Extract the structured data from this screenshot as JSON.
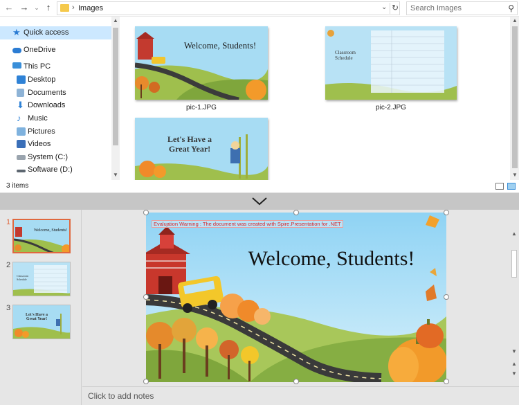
{
  "explorer": {
    "address": {
      "path": "Images"
    },
    "search": {
      "placeholder": "Search Images"
    },
    "nav": {
      "items": [
        {
          "label": "Quick access",
          "icon": "star-icon"
        },
        {
          "label": "OneDrive",
          "icon": "cloud-icon"
        },
        {
          "label": "This PC",
          "icon": "computer-icon"
        },
        {
          "label": "Desktop",
          "icon": "desktop-folder-icon"
        },
        {
          "label": "Documents",
          "icon": "documents-folder-icon"
        },
        {
          "label": "Downloads",
          "icon": "downloads-folder-icon"
        },
        {
          "label": "Music",
          "icon": "music-icon"
        },
        {
          "label": "Pictures",
          "icon": "pictures-folder-icon"
        },
        {
          "label": "Videos",
          "icon": "videos-folder-icon"
        },
        {
          "label": "System (C:)",
          "icon": "drive-icon"
        },
        {
          "label": "Software (D:)",
          "icon": "drive-icon"
        }
      ]
    },
    "files": [
      {
        "name": "pic-1.JPG",
        "title": "Welcome, Students!"
      },
      {
        "name": "pic-2.JPG",
        "title": "Classroom Schedule"
      },
      {
        "name": "",
        "title": "Let's Have a Great Year!"
      }
    ],
    "status": {
      "count": "3 items"
    },
    "colors": {
      "selected": "#cce8ff",
      "folder": "#f5c94c"
    }
  },
  "viewer": {
    "slides": [
      {
        "number": "1",
        "title": "Welcome, Students!"
      },
      {
        "number": "2",
        "title": "Classroom Schedule"
      },
      {
        "number": "3",
        "title": "Let's Have a Great Year!"
      }
    ],
    "current_slide": {
      "title": "Welcome, Students!",
      "warning": "Evaluation Warning : The document was created with  Spire.Presentation for .NET"
    },
    "notes_placeholder": "Click to add notes",
    "colors": {
      "active_thumb": "#e0683e",
      "sky": "#9fd7f2",
      "warning_text": "#d8262a"
    }
  }
}
